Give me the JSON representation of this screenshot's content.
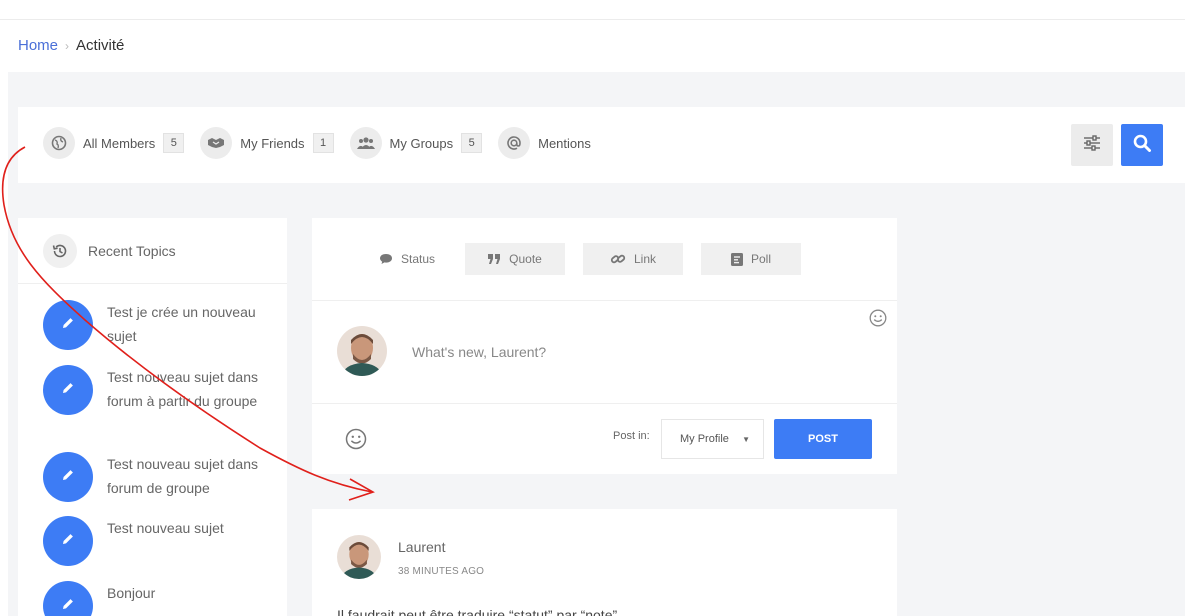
{
  "breadcrumb": {
    "home": "Home",
    "separator": "›",
    "current": "Activité"
  },
  "filters": [
    {
      "label": "All Members",
      "count": "5",
      "icon": "globe-icon"
    },
    {
      "label": "My Friends",
      "count": "1",
      "icon": "handshake-icon"
    },
    {
      "label": "My Groups",
      "count": "5",
      "icon": "users-icon"
    },
    {
      "label": "Mentions",
      "count": "",
      "icon": "at-icon"
    }
  ],
  "sidebar": {
    "title": "Recent Topics",
    "topics": [
      {
        "title": "Test je crée un nouveau sujet"
      },
      {
        "title": "Test nouveau sujet dans forum à partir du groupe"
      },
      {
        "title": "Test nouveau sujet dans forum de groupe"
      },
      {
        "title": "Test nouveau sujet"
      },
      {
        "title": "Bonjour"
      }
    ]
  },
  "composer": {
    "types": [
      {
        "label": "Status",
        "icon": "speech-bubble-icon"
      },
      {
        "label": "Quote",
        "icon": "quote-icon"
      },
      {
        "label": "Link",
        "icon": "link-icon"
      },
      {
        "label": "Poll",
        "icon": "poll-icon"
      }
    ],
    "placeholder": "What's new, Laurent?",
    "post_in_label": "Post in:",
    "post_in_value": "My Profile",
    "post_button": "POST"
  },
  "activity": {
    "author": "Laurent",
    "time": "38 MINUTES AGO",
    "content": "Il faudrait peut être traduire “statut” par “note”"
  },
  "colors": {
    "accent": "#3d7cf5",
    "link": "#4a6fd8",
    "annotation": "#e0201b"
  }
}
